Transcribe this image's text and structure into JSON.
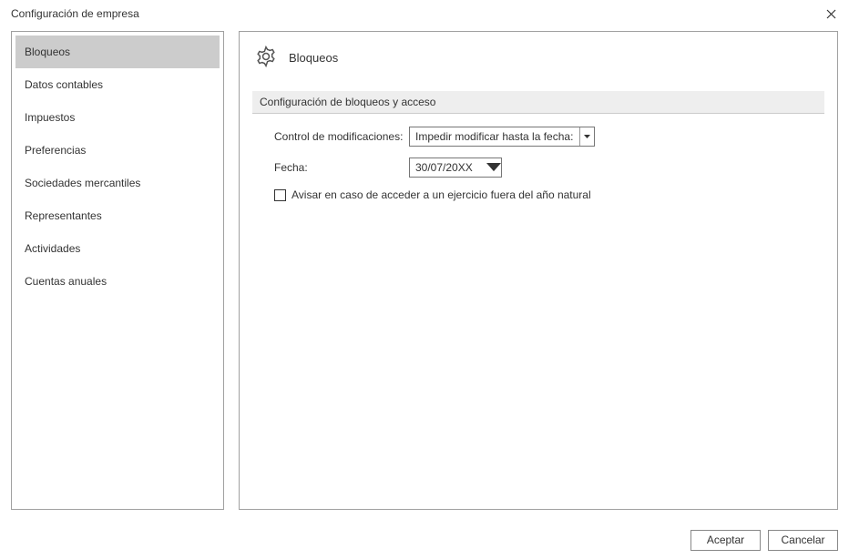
{
  "window": {
    "title": "Configuración de empresa"
  },
  "sidebar": {
    "items": [
      {
        "label": "Bloqueos",
        "selected": true
      },
      {
        "label": "Datos contables",
        "selected": false
      },
      {
        "label": "Impuestos",
        "selected": false
      },
      {
        "label": "Preferencias",
        "selected": false
      },
      {
        "label": "Sociedades mercantiles",
        "selected": false
      },
      {
        "label": "Representantes",
        "selected": false
      },
      {
        "label": "Actividades",
        "selected": false
      },
      {
        "label": "Cuentas anuales",
        "selected": false
      }
    ]
  },
  "panel": {
    "title": "Bloqueos",
    "section_title": "Configuración de bloqueos y acceso",
    "control_label": "Control de modificaciones:",
    "control_value": "Impedir modificar hasta la fecha:",
    "fecha_label": "Fecha:",
    "fecha_value": "30/07/20XX",
    "checkbox_label": "Avisar en caso de acceder a un ejercicio fuera del año natural",
    "checkbox_checked": false
  },
  "footer": {
    "accept": "Aceptar",
    "cancel": "Cancelar"
  }
}
